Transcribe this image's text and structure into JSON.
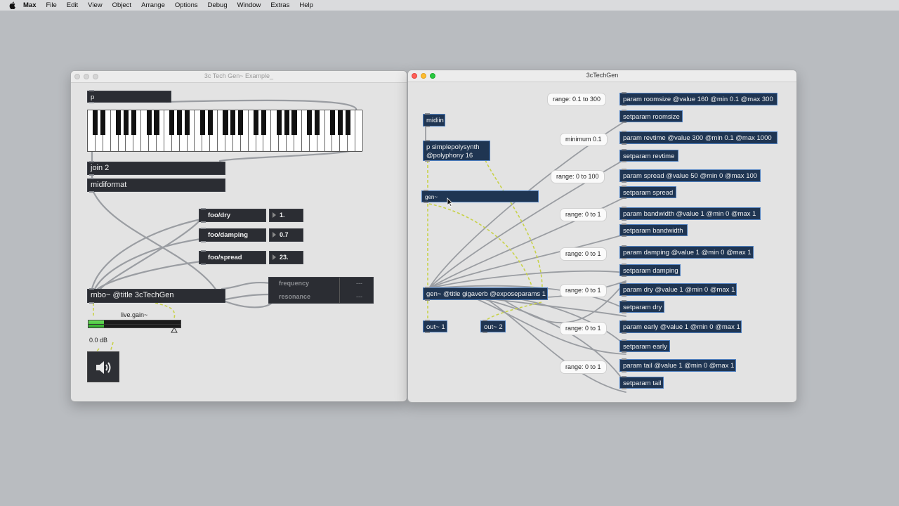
{
  "menubar": {
    "items": [
      "Max",
      "File",
      "Edit",
      "View",
      "Object",
      "Arrange",
      "Options",
      "Debug",
      "Window",
      "Extras",
      "Help"
    ]
  },
  "left_window": {
    "title": "3c Tech Gen~ Example_",
    "p_object": "p",
    "join": "join 2",
    "midiformat": "midiformat",
    "foo_dry": {
      "label": "foo/dry",
      "value": "1."
    },
    "foo_damping": {
      "label": "foo/damping",
      "value": "0.7"
    },
    "foo_spread": {
      "label": "foo/spread",
      "value": "23."
    },
    "rnbo": "rnbo~ @title 3cTechGen",
    "attr_frequency": {
      "label": "frequency",
      "value": "---"
    },
    "attr_resonance": {
      "label": "resonance",
      "value": "---"
    },
    "gain_label": "live.gain~",
    "gain_db": "0.0 dB",
    "gain_level": 0.17
  },
  "right_window": {
    "title": "3cTechGen",
    "midiin": "midiin",
    "simplepolysynth_line1": "p simplepolysynth",
    "simplepolysynth_line2": "@polyphony 16",
    "gen_small": "gen~",
    "gen_main": "gen~ @title gigaverb @exposeparams 1",
    "out1": "out~ 1",
    "out2": "out~ 2",
    "params": [
      {
        "range": "range: 0.1 to 300",
        "param": "param roomsize @value 160 @min 0.1 @max 300",
        "setparam": "setparam roomsize"
      },
      {
        "range": "minimum 0.1",
        "param": "param revtime @value 300 @min 0.1 @max 1000",
        "setparam": "setparam revtime"
      },
      {
        "range": "range: 0 to 100",
        "param": "param spread @value 50 @min 0 @max 100",
        "setparam": "setparam spread"
      },
      {
        "range": "range: 0 to 1",
        "param": "param bandwidth @value 1 @min 0 @max 1",
        "setparam": "setparam bandwidth"
      },
      {
        "range": "range: 0 to 1",
        "param": "param damping @value 1 @min 0 @max 1",
        "setparam": "setparam damping"
      },
      {
        "range": "range: 0 to 1",
        "param": "param dry @value 1 @min 0 @max 1",
        "setparam": "setparam dry"
      },
      {
        "range": "range: 0 to 1",
        "param": "param early @value 1 @min 0 @max 1",
        "setparam": "setparam early"
      },
      {
        "range": "range: 0 to 1",
        "param": "param tail @value 1 @min 0 @max 1",
        "setparam": "setparam tail"
      }
    ]
  },
  "colors": {
    "object_bg": "#2b2d33",
    "selected_bg": "#1f3552",
    "cord": "#9a9da2",
    "signal_cord": "#c8d24a",
    "meter_green": "#4fd046"
  }
}
